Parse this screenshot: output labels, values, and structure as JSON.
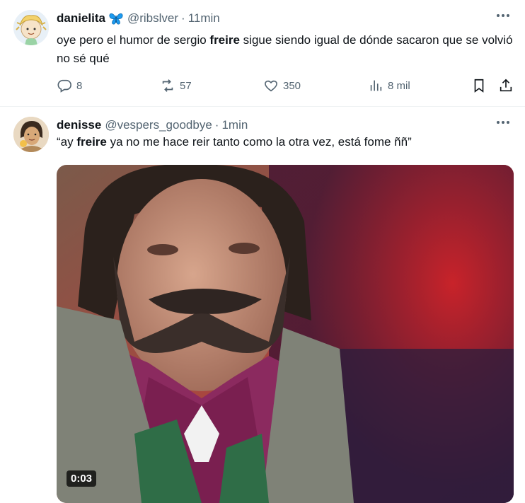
{
  "tweets": [
    {
      "display_name": "danielita",
      "handle": "@ribslver",
      "separator": "·",
      "time": "11min",
      "text_before": "oye pero el humor de sergio ",
      "text_bold": "freire",
      "text_after": " sigue siendo igual de dónde sacaron que se volvió no sé qué",
      "actions": {
        "replies": "8",
        "reposts": "57",
        "likes": "350",
        "views": "8 mil"
      }
    },
    {
      "display_name": "denisse",
      "handle": "@vespers_goodbye",
      "separator": "·",
      "time": "1min",
      "text_before": "“ay ",
      "text_bold": "freire",
      "text_after": " ya no me hace reir tanto como la otra vez, está  fome ññ”",
      "video_duration": "0:03"
    }
  ],
  "colors": {
    "text_primary": "#0f1419",
    "text_secondary": "#536471",
    "butterfly": "#1d9bf0"
  },
  "icons": [
    "reply-icon",
    "repost-icon",
    "like-icon",
    "views-icon",
    "bookmark-icon",
    "share-icon",
    "more-icon",
    "butterfly-emoji-icon"
  ]
}
